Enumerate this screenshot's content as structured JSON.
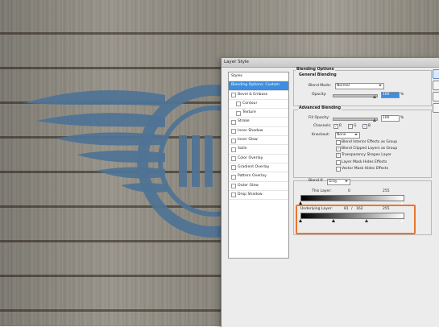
{
  "dialog": {
    "title": "Layer Style",
    "sidebar": {
      "items": [
        {
          "label": "Styles",
          "type": "plain",
          "selected": false
        },
        {
          "label": "Blending Options: Custom",
          "type": "plain",
          "selected": true
        },
        {
          "label": "Bevel & Emboss",
          "type": "check",
          "selected": false
        },
        {
          "label": "Contour",
          "type": "indent",
          "selected": false
        },
        {
          "label": "Texture",
          "type": "indent",
          "selected": false
        },
        {
          "label": "Stroke",
          "type": "check",
          "selected": false
        },
        {
          "label": "Inner Shadow",
          "type": "check",
          "selected": false
        },
        {
          "label": "Inner Glow",
          "type": "check",
          "selected": false
        },
        {
          "label": "Satin",
          "type": "check",
          "selected": false
        },
        {
          "label": "Color Overlay",
          "type": "check",
          "selected": false
        },
        {
          "label": "Gradient Overlay",
          "type": "check",
          "selected": false
        },
        {
          "label": "Pattern Overlay",
          "type": "check",
          "selected": false
        },
        {
          "label": "Outer Glow",
          "type": "check",
          "selected": false
        },
        {
          "label": "Drop Shadow",
          "type": "check",
          "selected": false
        }
      ]
    },
    "blending_options": {
      "title": "Blending Options",
      "general": {
        "title": "General Blending",
        "blend_mode_label": "Blend Mode:",
        "blend_mode_value": "Normal",
        "opacity_label": "Opacity:",
        "opacity_value": "100",
        "percent": "%"
      },
      "advanced": {
        "title": "Advanced Blending",
        "fill_opacity_label": "Fill Opacity:",
        "fill_opacity_value": "100",
        "percent": "%",
        "channels_label": "Channels:",
        "channels": [
          "R",
          "G",
          "B"
        ],
        "knockout_label": "Knockout:",
        "knockout_value": "None",
        "options": [
          {
            "label": "Blend Interior Effects as Group",
            "checked": false
          },
          {
            "label": "Blend Clipped Layers as Group",
            "checked": true
          },
          {
            "label": "Transparency Shapes Layer",
            "checked": true
          },
          {
            "label": "Layer Mask Hides Effects",
            "checked": false
          },
          {
            "label": "Vector Mask Hides Effects",
            "checked": false
          }
        ]
      },
      "blend_if": {
        "label": "Blend If:",
        "value": "Gray",
        "this_layer_label": "This Layer:",
        "this_layer_low": "0",
        "this_layer_high": "255",
        "underlying_label": "Underlying Layer:",
        "underlying_low": "81",
        "underlying_mid": "162",
        "underlying_slash": "/",
        "underlying_high": "255",
        "underlying_split": [
          81,
          162,
          255
        ]
      }
    }
  },
  "colors": {
    "logo": "#4f7394",
    "highlight": "#e8772f",
    "selection": "#3d8ee0"
  }
}
